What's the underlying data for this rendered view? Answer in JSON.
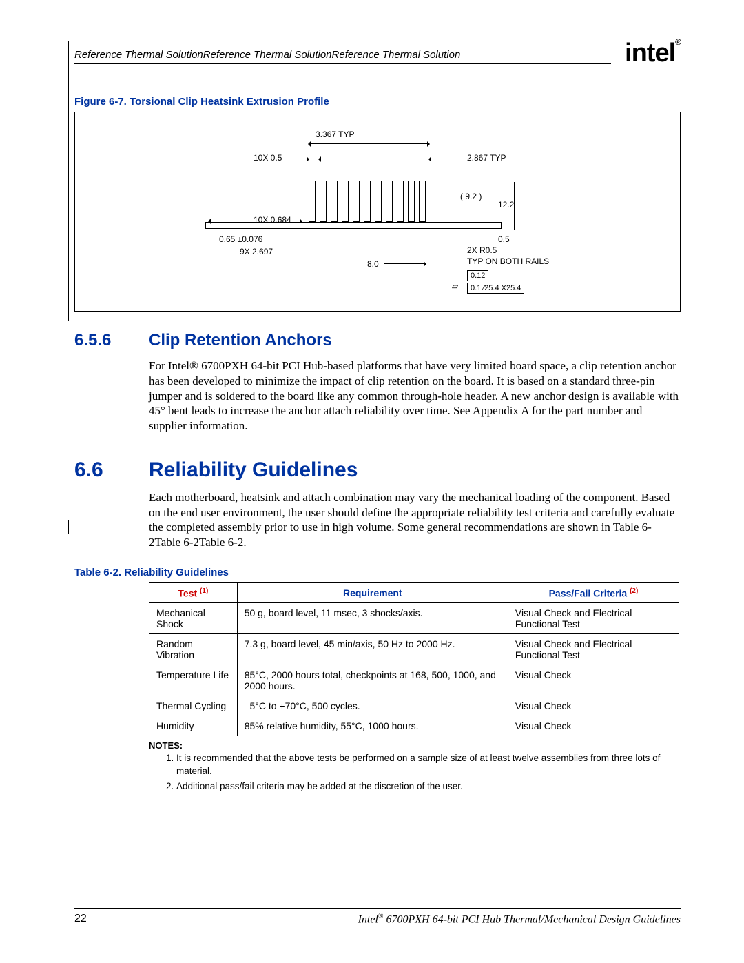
{
  "header": {
    "running_head": "Reference Thermal SolutionReference Thermal SolutionReference Thermal Solution",
    "logo_text": "intel",
    "logo_reg": "®"
  },
  "figure": {
    "caption": "Figure 6-7. Torsional Clip Heatsink Extrusion Profile",
    "labels": {
      "top_width": "3.367  TYP",
      "fin_count": "10X  0.5",
      "right_width": "2.867  TYP",
      "height_paren": "( 9.2 )",
      "height_full": "12.2",
      "gap": "10X  0.684",
      "left_tol": "0.65  ±0.076",
      "left_rep": "9X  2.697",
      "base_len": "8.0",
      "right_base": "0.5",
      "fillet": "2X  R0.5",
      "note_rails": "TYP  ON  BOTH  RAILS",
      "gd1": "0.12",
      "gd2": "0.1  ∕25.4  X25.4"
    }
  },
  "sec_656": {
    "num": "6.5.6",
    "title": "Clip Retention Anchors",
    "para": "For Intel® 6700PXH 64-bit PCI Hub-based platforms that have very limited board space, a clip retention anchor has been developed to minimize the impact of clip retention on the board. It is based on a standard three-pin jumper and is soldered to the board like any common through-hole header. A new anchor design is available with 45° bent leads to increase the anchor attach reliability over time. See Appendix A for the part number and supplier information."
  },
  "sec_66": {
    "num": "6.6",
    "title": "Reliability Guidelines",
    "para": "Each motherboard, heatsink and attach combination may vary the mechanical loading of the component. Based on the end user environment, the user should define the appropriate reliability test criteria and carefully evaluate the completed assembly prior to use in high volume. Some general recommendations are shown in Table 6-2Table 6-2Table 6-2."
  },
  "table": {
    "caption": "Table 6-2. Reliability Guidelines",
    "head": {
      "c1": "Test",
      "c1_sup": "(1)",
      "c2": "Requirement",
      "c3": "Pass/Fail Criteria",
      "c3_sup": "(2)"
    },
    "rows": [
      {
        "test": "Mechanical Shock",
        "req": "50 g, board level, 11 msec, 3 shocks/axis.",
        "pf": "Visual Check and Electrical Functional Test"
      },
      {
        "test": "Random Vibration",
        "req": "7.3 g, board level, 45 min/axis, 50 Hz to 2000 Hz.",
        "pf": "Visual Check and Electrical Functional Test"
      },
      {
        "test": "Temperature Life",
        "req": "85°C, 2000 hours total, checkpoints at 168, 500, 1000, and 2000 hours.",
        "pf": "Visual Check"
      },
      {
        "test": "Thermal Cycling",
        "req": "–5°C to +70°C, 500 cycles.",
        "pf": "Visual Check"
      },
      {
        "test": "Humidity",
        "req": "85% relative humidity, 55°C, 1000 hours.",
        "pf": "Visual Check"
      }
    ],
    "notes_head": "NOTES:",
    "notes": [
      "It is recommended that the above tests be performed on a sample size of at least twelve assemblies from three lots of material.",
      "Additional pass/fail criteria may be added at the discretion of the user."
    ]
  },
  "footer": {
    "page": "22",
    "title_pre": "Intel",
    "title_sup": "®",
    "title_post": " 6700PXH 64-bit PCI Hub Thermal/Mechanical Design Guidelines"
  }
}
